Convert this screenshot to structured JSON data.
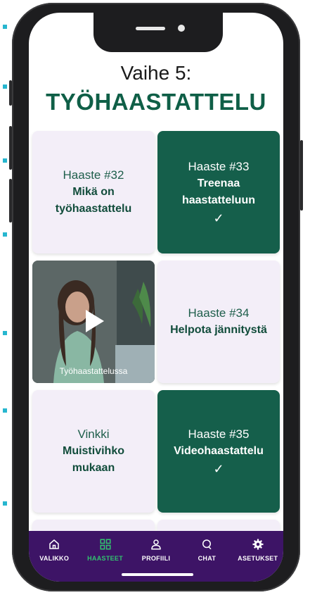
{
  "header": {
    "step": "Vaihe 5:",
    "title": "TYÖHAASTATTELU"
  },
  "cards": [
    {
      "label": "Haaste #32",
      "name": "Mikä on\ntyöhaastattelu",
      "completed": false
    },
    {
      "label": "Haaste #33",
      "name": "Treenaa\nhaastatteluun",
      "completed": true,
      "check": "✓"
    },
    {
      "label": "Haaste #34",
      "name": "Helpota jännitystä",
      "completed": false
    },
    {
      "label": "Vinkki",
      "name": "Muistivihko\nmukaan",
      "completed": false
    },
    {
      "label": "Haaste #35",
      "name": "Videohaastattelu",
      "completed": true,
      "check": "✓"
    }
  ],
  "video": {
    "caption": "Työhaastattelussa"
  },
  "nav": [
    {
      "label": "VALIKKO",
      "icon": "home-icon"
    },
    {
      "label": "HAASTEET",
      "icon": "grid-icon",
      "active": true
    },
    {
      "label": "PROFIILI",
      "icon": "user-icon"
    },
    {
      "label": "CHAT",
      "icon": "chat-icon"
    },
    {
      "label": "ASETUKSET",
      "icon": "gear-icon"
    }
  ],
  "colors": {
    "brand_green": "#155f4b",
    "card_light": "#f3eef8",
    "nav_purple": "#3d1466",
    "nav_active": "#31c36f",
    "accent_dots": "#27b6cf"
  }
}
